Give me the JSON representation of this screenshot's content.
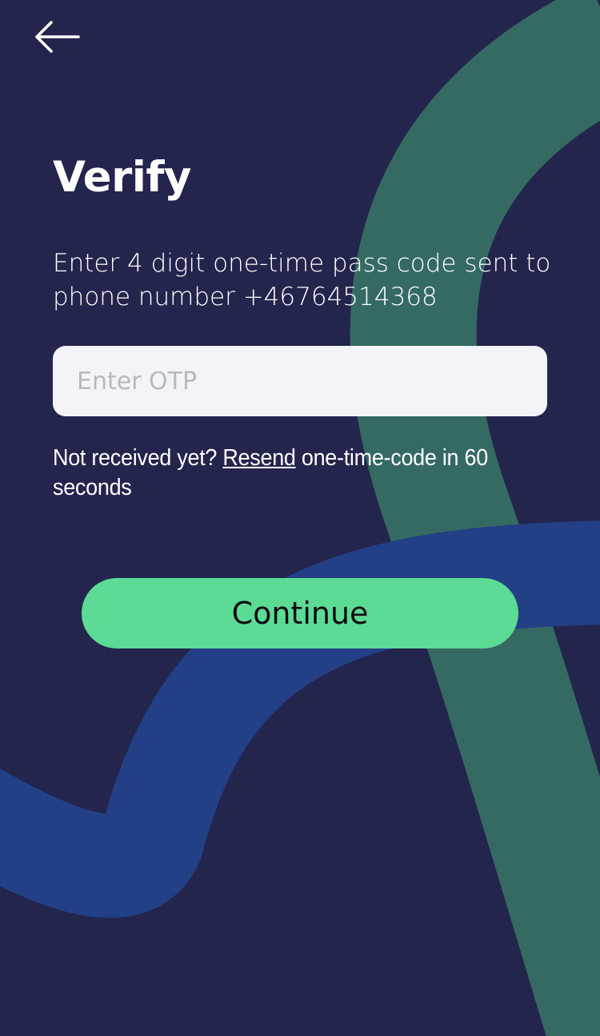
{
  "header": {
    "back_icon": "arrow-left-icon"
  },
  "verify": {
    "title": "Verify",
    "instructions": "Enter 4 digit one-time pass code sent to phone number +46764514368",
    "otp_value": "",
    "otp_placeholder": "Enter OTP",
    "resend_prefix": "Not received yet? ",
    "resend_link": "Resend",
    "resend_suffix": " one-time-code in 60 seconds",
    "continue_label": "Continue"
  },
  "colors": {
    "background": "#23254d",
    "accent_green": "#5cdb95",
    "ribbon_teal": "#356a63",
    "ribbon_blue": "#233f85",
    "input_bg": "#f3f4f8"
  }
}
